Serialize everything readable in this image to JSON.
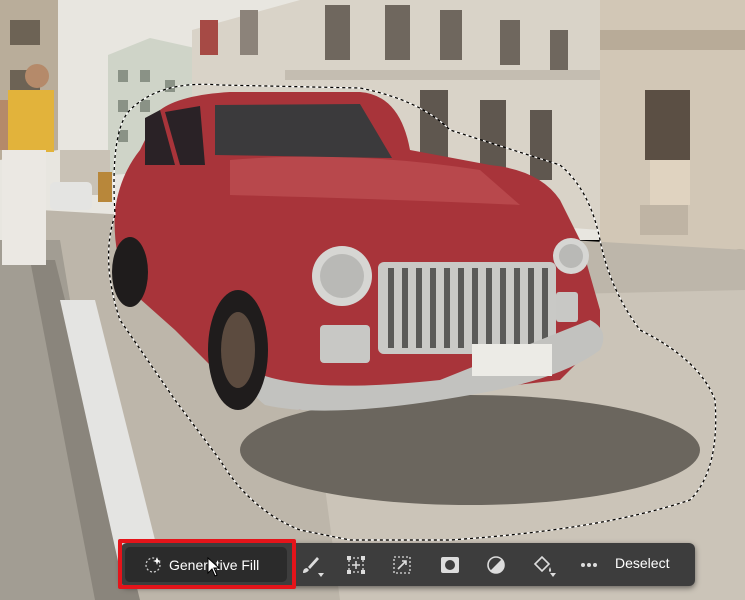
{
  "taskbar": {
    "generative_fill_label": "Generative Fill",
    "deselect_label": "Deselect"
  },
  "icons": {
    "generative_fill": "sparkle-icon",
    "brush": "brush-icon",
    "transform": "transform-selection-icon",
    "invert": "invert-selection-icon",
    "mask": "add-mask-icon",
    "adjustment": "adjustment-layer-icon",
    "fill": "paint-bucket-icon",
    "more": "more-options-icon"
  },
  "colors": {
    "highlight": "#e4141a",
    "taskbar_bg": "#3d3d3d",
    "car_red": "#a8343a"
  }
}
